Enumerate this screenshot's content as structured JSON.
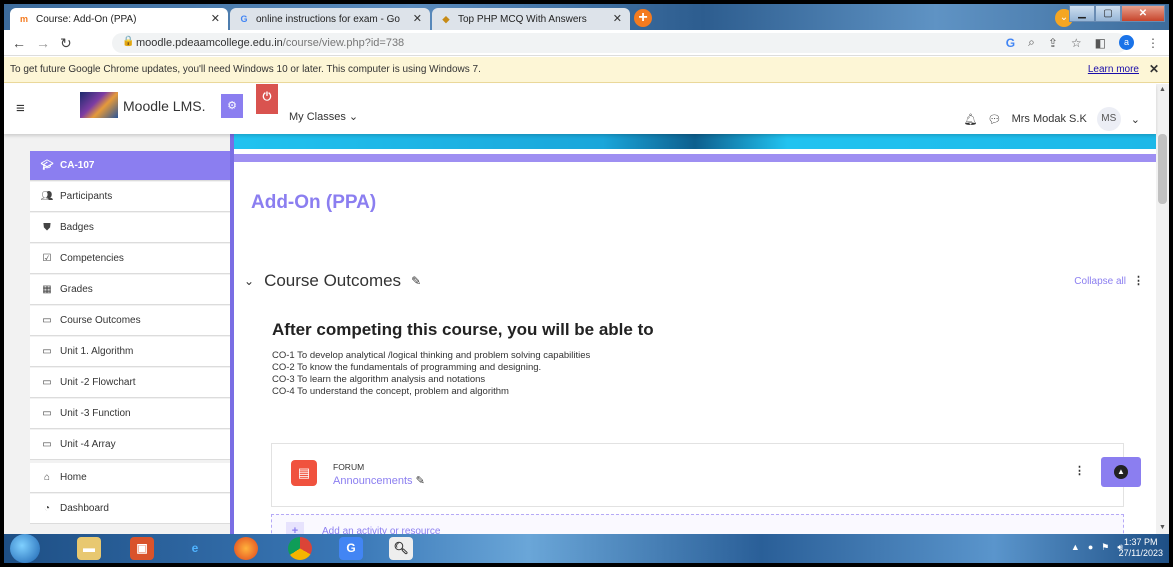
{
  "browser": {
    "tabs": [
      {
        "label": "Course: Add-On (PPA)",
        "favicon": "moodle-icon",
        "active": true
      },
      {
        "label": "online instructions for exam - Go",
        "favicon": "google-icon",
        "active": false
      },
      {
        "label": "Top PHP MCQ With Answers",
        "favicon": "web-icon",
        "active": false
      }
    ],
    "url_host": "moodle.pdeaamcollege.edu.in",
    "url_path": "/course/view.php?id=738",
    "profile_initial": "a",
    "infobar_message": "To get future Google Chrome updates, you'll need Windows 10 or later. This computer is using Windows 7.",
    "infobar_link": "Learn more"
  },
  "navbar": {
    "brand": "Moodle LMS.",
    "menu_label": "My Classes",
    "user_name": "Mrs Modak S.K",
    "user_initials": "MS"
  },
  "drawer": {
    "items": [
      {
        "label": "CA-107",
        "icon": "graduation-cap-icon",
        "active": true
      },
      {
        "label": "Participants",
        "icon": "users-icon"
      },
      {
        "label": "Badges",
        "icon": "shield-icon"
      },
      {
        "label": "Competencies",
        "icon": "check-square-icon"
      },
      {
        "label": "Grades",
        "icon": "table-icon"
      },
      {
        "label": "Course Outcomes",
        "icon": "folder-icon"
      },
      {
        "label": "Unit 1. Algorithm",
        "icon": "folder-icon"
      },
      {
        "label": "Unit -2 Flowchart",
        "icon": "folder-icon"
      },
      {
        "label": "Unit -3 Function",
        "icon": "folder-icon"
      },
      {
        "label": "Unit -4 Array",
        "icon": "folder-icon"
      },
      {
        "label": "Home",
        "icon": "home-icon"
      },
      {
        "label": "Dashboard",
        "icon": "dashboard-icon"
      }
    ]
  },
  "main": {
    "course_title": "Add-On (PPA)",
    "section_title": "Course Outcomes",
    "collapse_all": "Collapse all",
    "summary_heading": "After competing this course, you will be able to",
    "outcomes": [
      "CO-1 To develop analytical /logical thinking and problem solving capabilities",
      "CO-2 To know the fundamentals of programming and designing.",
      "CO-3 To learn the algorithm analysis and notations",
      "CO-4 To understand the concept, problem and algorithm"
    ],
    "activity": {
      "type_label": "FORUM",
      "name": "Announcements"
    },
    "add_activity": "Add an activity or resource"
  },
  "taskbar": {
    "time": "1:37 PM",
    "date": "27/11/2023"
  },
  "colors": {
    "accent": "#8b7ef0",
    "forum_icon": "#f0523e",
    "power_button": "#d9534f"
  }
}
